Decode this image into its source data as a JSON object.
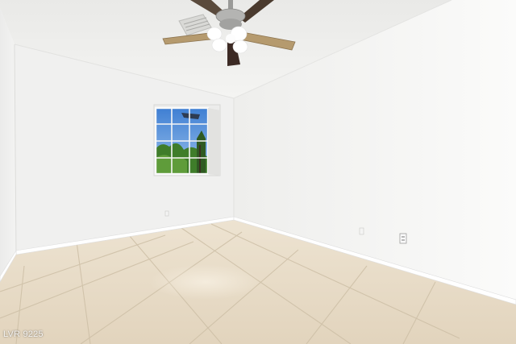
{
  "photo": {
    "kind": "empty-room-interior",
    "watermark": "LVR 9225",
    "colors": {
      "ceiling": "#eeeeec",
      "wall_left": "#f2f2f1",
      "wall_right": "#f6f6f5",
      "wall_back": "#efefee",
      "floor_tile": "#e6d9c3",
      "grout": "#cbbfa9",
      "fan_blade": "#b59a6e",
      "sky": "#4f8ad6"
    },
    "objects": [
      "ceiling-fan",
      "air-vent",
      "window",
      "baseboard",
      "electrical-outlet",
      "tile-floor"
    ]
  }
}
